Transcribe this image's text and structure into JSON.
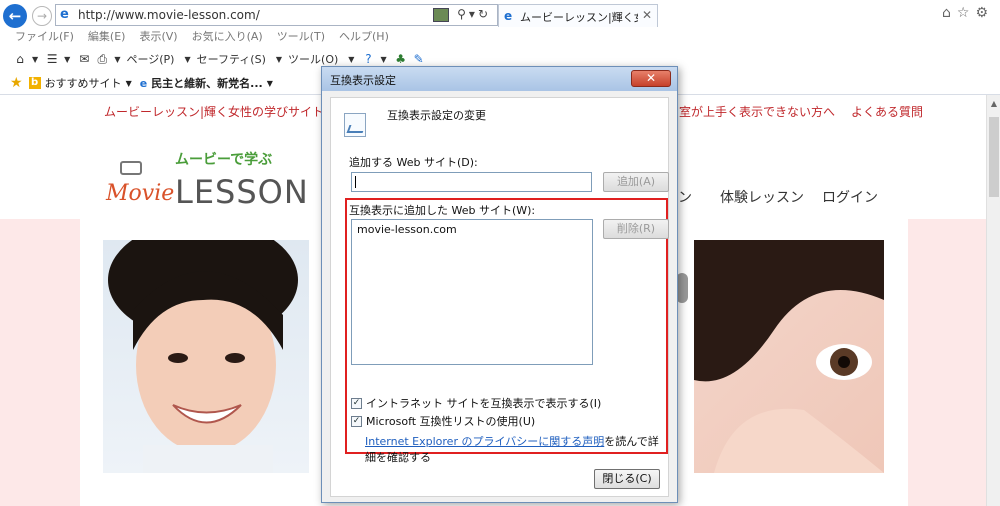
{
  "browser": {
    "url": "http://www.movie-lesson.com/",
    "tab_title": "ムービーレッスン|輝く女…",
    "menu": [
      "ファイル(F)",
      "編集(E)",
      "表示(V)",
      "お気に入り(A)",
      "ツール(T)",
      "ヘルプ(H)"
    ],
    "commands": [
      "ページ(P)",
      "セーフティ(S)",
      "ツール(O)"
    ],
    "favorites": [
      "おすすめサイト",
      "民主と維新、新党名..."
    ]
  },
  "page": {
    "top_link": "ムービーレッスン|輝く女性の学びサイト",
    "top_right_links": [
      "室が上手く表示できない方へ",
      "よくある質問"
    ],
    "logo_tagline": "ムービーで学ぶ",
    "logo_movie": "Movie",
    "logo_lesson": "LESSON",
    "nav_partial": "ン",
    "nav_trial": "体験レッスン",
    "nav_login": "ログイン"
  },
  "dialog": {
    "title": "互換表示設定",
    "header": "互換表示設定の変更",
    "add_label": "追加する Web サイト(D):",
    "add_value": "",
    "add_button": "追加(A)",
    "list_label": "互換表示に追加した Web サイト(W):",
    "sites": [
      "movie-lesson.com"
    ],
    "remove_button": "削除(R)",
    "intranet_label": "イントラネット サイトを互換表示で表示する(I)",
    "intranet_checked": true,
    "mslist_label": "Microsoft 互換性リストの使用(U)",
    "mslist_checked": true,
    "privacy_link": "Internet Explorer のプライバシーに関する声明",
    "privacy_suffix": "を読んで詳細を確認する",
    "close_button": "閉じる(C)"
  },
  "colors": {
    "accent_red": "#c0282c",
    "highlight_box": "#e02020",
    "link_blue": "#1f5fbf"
  }
}
